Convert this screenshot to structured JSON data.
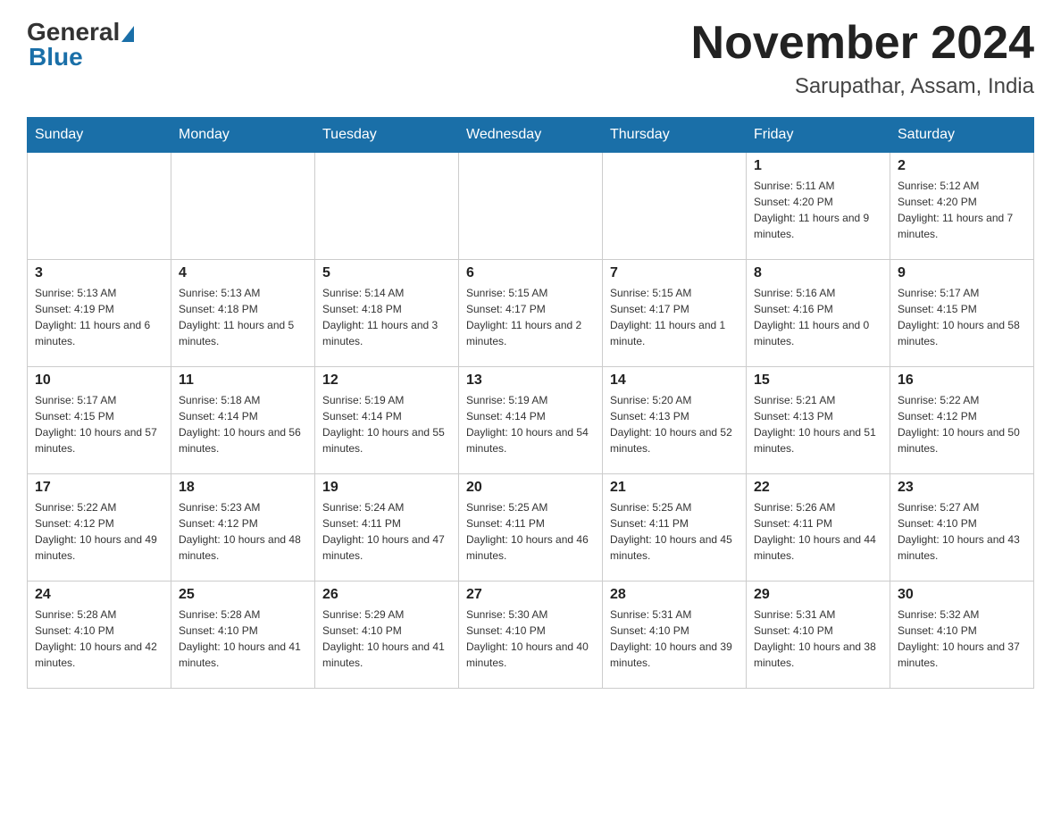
{
  "header": {
    "logo_general": "General",
    "logo_blue": "Blue",
    "month_title": "November 2024",
    "location": "Sarupathar, Assam, India"
  },
  "days_of_week": [
    "Sunday",
    "Monday",
    "Tuesday",
    "Wednesday",
    "Thursday",
    "Friday",
    "Saturday"
  ],
  "weeks": [
    [
      {
        "day": "",
        "info": ""
      },
      {
        "day": "",
        "info": ""
      },
      {
        "day": "",
        "info": ""
      },
      {
        "day": "",
        "info": ""
      },
      {
        "day": "",
        "info": ""
      },
      {
        "day": "1",
        "info": "Sunrise: 5:11 AM\nSunset: 4:20 PM\nDaylight: 11 hours and 9 minutes."
      },
      {
        "day": "2",
        "info": "Sunrise: 5:12 AM\nSunset: 4:20 PM\nDaylight: 11 hours and 7 minutes."
      }
    ],
    [
      {
        "day": "3",
        "info": "Sunrise: 5:13 AM\nSunset: 4:19 PM\nDaylight: 11 hours and 6 minutes."
      },
      {
        "day": "4",
        "info": "Sunrise: 5:13 AM\nSunset: 4:18 PM\nDaylight: 11 hours and 5 minutes."
      },
      {
        "day": "5",
        "info": "Sunrise: 5:14 AM\nSunset: 4:18 PM\nDaylight: 11 hours and 3 minutes."
      },
      {
        "day": "6",
        "info": "Sunrise: 5:15 AM\nSunset: 4:17 PM\nDaylight: 11 hours and 2 minutes."
      },
      {
        "day": "7",
        "info": "Sunrise: 5:15 AM\nSunset: 4:17 PM\nDaylight: 11 hours and 1 minute."
      },
      {
        "day": "8",
        "info": "Sunrise: 5:16 AM\nSunset: 4:16 PM\nDaylight: 11 hours and 0 minutes."
      },
      {
        "day": "9",
        "info": "Sunrise: 5:17 AM\nSunset: 4:15 PM\nDaylight: 10 hours and 58 minutes."
      }
    ],
    [
      {
        "day": "10",
        "info": "Sunrise: 5:17 AM\nSunset: 4:15 PM\nDaylight: 10 hours and 57 minutes."
      },
      {
        "day": "11",
        "info": "Sunrise: 5:18 AM\nSunset: 4:14 PM\nDaylight: 10 hours and 56 minutes."
      },
      {
        "day": "12",
        "info": "Sunrise: 5:19 AM\nSunset: 4:14 PM\nDaylight: 10 hours and 55 minutes."
      },
      {
        "day": "13",
        "info": "Sunrise: 5:19 AM\nSunset: 4:14 PM\nDaylight: 10 hours and 54 minutes."
      },
      {
        "day": "14",
        "info": "Sunrise: 5:20 AM\nSunset: 4:13 PM\nDaylight: 10 hours and 52 minutes."
      },
      {
        "day": "15",
        "info": "Sunrise: 5:21 AM\nSunset: 4:13 PM\nDaylight: 10 hours and 51 minutes."
      },
      {
        "day": "16",
        "info": "Sunrise: 5:22 AM\nSunset: 4:12 PM\nDaylight: 10 hours and 50 minutes."
      }
    ],
    [
      {
        "day": "17",
        "info": "Sunrise: 5:22 AM\nSunset: 4:12 PM\nDaylight: 10 hours and 49 minutes."
      },
      {
        "day": "18",
        "info": "Sunrise: 5:23 AM\nSunset: 4:12 PM\nDaylight: 10 hours and 48 minutes."
      },
      {
        "day": "19",
        "info": "Sunrise: 5:24 AM\nSunset: 4:11 PM\nDaylight: 10 hours and 47 minutes."
      },
      {
        "day": "20",
        "info": "Sunrise: 5:25 AM\nSunset: 4:11 PM\nDaylight: 10 hours and 46 minutes."
      },
      {
        "day": "21",
        "info": "Sunrise: 5:25 AM\nSunset: 4:11 PM\nDaylight: 10 hours and 45 minutes."
      },
      {
        "day": "22",
        "info": "Sunrise: 5:26 AM\nSunset: 4:11 PM\nDaylight: 10 hours and 44 minutes."
      },
      {
        "day": "23",
        "info": "Sunrise: 5:27 AM\nSunset: 4:10 PM\nDaylight: 10 hours and 43 minutes."
      }
    ],
    [
      {
        "day": "24",
        "info": "Sunrise: 5:28 AM\nSunset: 4:10 PM\nDaylight: 10 hours and 42 minutes."
      },
      {
        "day": "25",
        "info": "Sunrise: 5:28 AM\nSunset: 4:10 PM\nDaylight: 10 hours and 41 minutes."
      },
      {
        "day": "26",
        "info": "Sunrise: 5:29 AM\nSunset: 4:10 PM\nDaylight: 10 hours and 41 minutes."
      },
      {
        "day": "27",
        "info": "Sunrise: 5:30 AM\nSunset: 4:10 PM\nDaylight: 10 hours and 40 minutes."
      },
      {
        "day": "28",
        "info": "Sunrise: 5:31 AM\nSunset: 4:10 PM\nDaylight: 10 hours and 39 minutes."
      },
      {
        "day": "29",
        "info": "Sunrise: 5:31 AM\nSunset: 4:10 PM\nDaylight: 10 hours and 38 minutes."
      },
      {
        "day": "30",
        "info": "Sunrise: 5:32 AM\nSunset: 4:10 PM\nDaylight: 10 hours and 37 minutes."
      }
    ]
  ]
}
